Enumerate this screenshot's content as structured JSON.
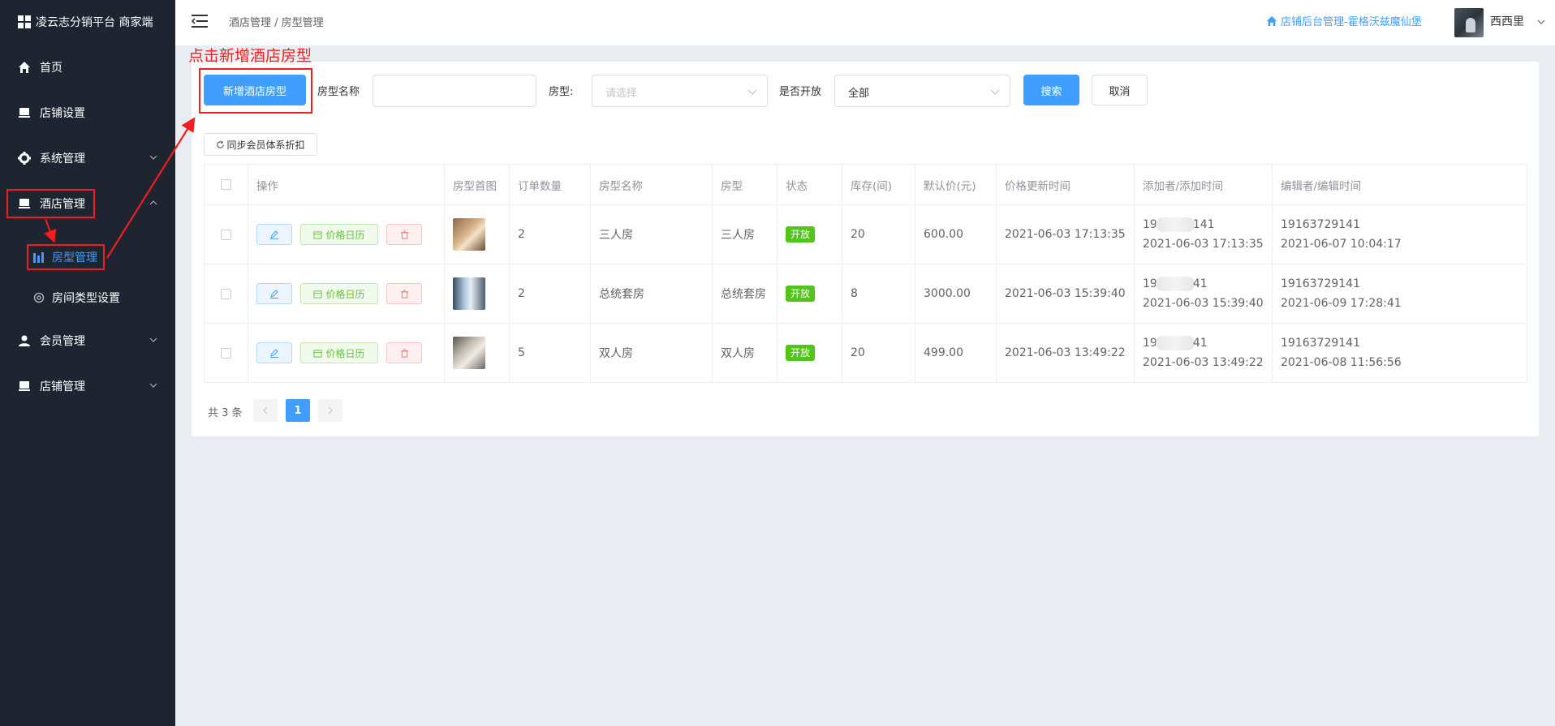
{
  "sidebar": {
    "logo_text": "凌云志分销平台 商家端",
    "items": [
      {
        "label": "首页"
      },
      {
        "label": "店铺设置"
      },
      {
        "label": "系统管理"
      },
      {
        "label": "酒店管理"
      },
      {
        "label": "会员管理"
      },
      {
        "label": "店铺管理"
      }
    ],
    "sub_items": [
      {
        "label": "房型管理"
      },
      {
        "label": "房间类型设置"
      }
    ]
  },
  "header": {
    "breadcrumb": "酒店管理 / 房型管理",
    "shop_link": "店铺后台管理-霍格沃兹魔仙堡",
    "username": "西西里"
  },
  "annotation": "点击新增酒店房型",
  "filters": {
    "add_button": "新增酒店房型",
    "name_label": "房型名称",
    "name_value": "",
    "type_label": "房型:",
    "type_placeholder": "请选择",
    "open_label": "是否开放",
    "open_value": "全部",
    "search_button": "搜索",
    "cancel_button": "取消"
  },
  "sync_button": "同步会员体系折扣",
  "table": {
    "columns": [
      "操作",
      "房型首图",
      "订单数量",
      "房型名称",
      "房型",
      "状态",
      "库存(间)",
      "默认价(元)",
      "价格更新时间",
      "添加者/添加时间",
      "编辑者/编辑时间"
    ],
    "action_calendar_label": "价格日历",
    "rows": [
      {
        "orders": "2",
        "name": "三人房",
        "type": "三人房",
        "status": "开放",
        "stock": "20",
        "price": "600.00",
        "price_updated": "2021-06-03 17:13:35",
        "adder_prefix": "19",
        "adder_suffix": "141",
        "added_time": "2021-06-03 17:13:35",
        "editor": "19163729141",
        "edited_time": "2021-06-07 10:04:17"
      },
      {
        "orders": "2",
        "name": "总统套房",
        "type": "总统套房",
        "status": "开放",
        "stock": "8",
        "price": "3000.00",
        "price_updated": "2021-06-03 15:39:40",
        "adder_prefix": "19",
        "adder_suffix": "41",
        "added_time": "2021-06-03 15:39:40",
        "editor": "19163729141",
        "edited_time": "2021-06-09 17:28:41"
      },
      {
        "orders": "5",
        "name": "双人房",
        "type": "双人房",
        "status": "开放",
        "stock": "20",
        "price": "499.00",
        "price_updated": "2021-06-03 13:49:22",
        "adder_prefix": "19",
        "adder_suffix": "41",
        "added_time": "2021-06-03 13:49:22",
        "editor": "19163729141",
        "edited_time": "2021-06-08 11:56:56"
      }
    ]
  },
  "pagination": {
    "total": "共 3 条",
    "current_page": "1"
  },
  "colors": {
    "sidebar_bg": "#1f2530",
    "primary": "#409eff",
    "success": "#52c41a",
    "annotation_red": "#f01e1e"
  }
}
